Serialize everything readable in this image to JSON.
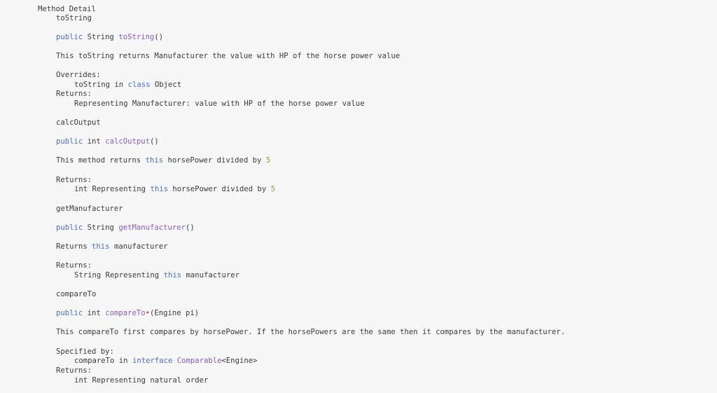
{
  "section_title": "Method Detail",
  "methods": [
    {
      "name": "toString",
      "signature": {
        "modifier": "public",
        "type": "String",
        "fn": "toString",
        "params": "()"
      },
      "description": "This toString returns Manufacturer the value with HP of the horse power value",
      "overrides_label": "Overrides:",
      "overrides": {
        "method": "toString",
        "in": "in",
        "kw": "class",
        "target": "Object"
      },
      "returns_label": "Returns:",
      "returns": "Representing Manufacturer: value with HP of the horse power value"
    },
    {
      "name": "calcOutput",
      "signature": {
        "modifier": "public",
        "type": "int",
        "fn": "calcOutput",
        "params": "()"
      },
      "description": {
        "pre": "This method returns",
        "kw": "this",
        "mid": "horsePower divided by",
        "num": "5"
      },
      "returns_label": "Returns:",
      "returns": {
        "pre": "int Representing",
        "kw": "this",
        "mid": "horsePower divided by",
        "num": "5"
      }
    },
    {
      "name": "getManufacturer",
      "signature": {
        "modifier": "public",
        "type": "String",
        "fn": "getManufacturer",
        "params": "()"
      },
      "description": {
        "pre": "Returns",
        "kw": "this",
        "post": "manufacturer"
      },
      "returns_label": "Returns:",
      "returns": {
        "pre": "String Representing",
        "kw": "this",
        "post": "manufacturer"
      }
    },
    {
      "name": "compareTo",
      "signature": {
        "modifier": "public",
        "type": "int",
        "fn": "compareTo",
        "marker": "•",
        "params": "(Engine pi)"
      },
      "description": "This compareTo first compares by horsePower. If the horsePowers are the same then it compares by the manufacturer.",
      "specified_label": "Specified by:",
      "specified": {
        "method": "compareTo",
        "in": "in",
        "kw": "interface",
        "target": "Comparable",
        "generic": "<Engine>"
      },
      "returns_label": "Returns:",
      "returns": "int Representing natural order"
    }
  ]
}
